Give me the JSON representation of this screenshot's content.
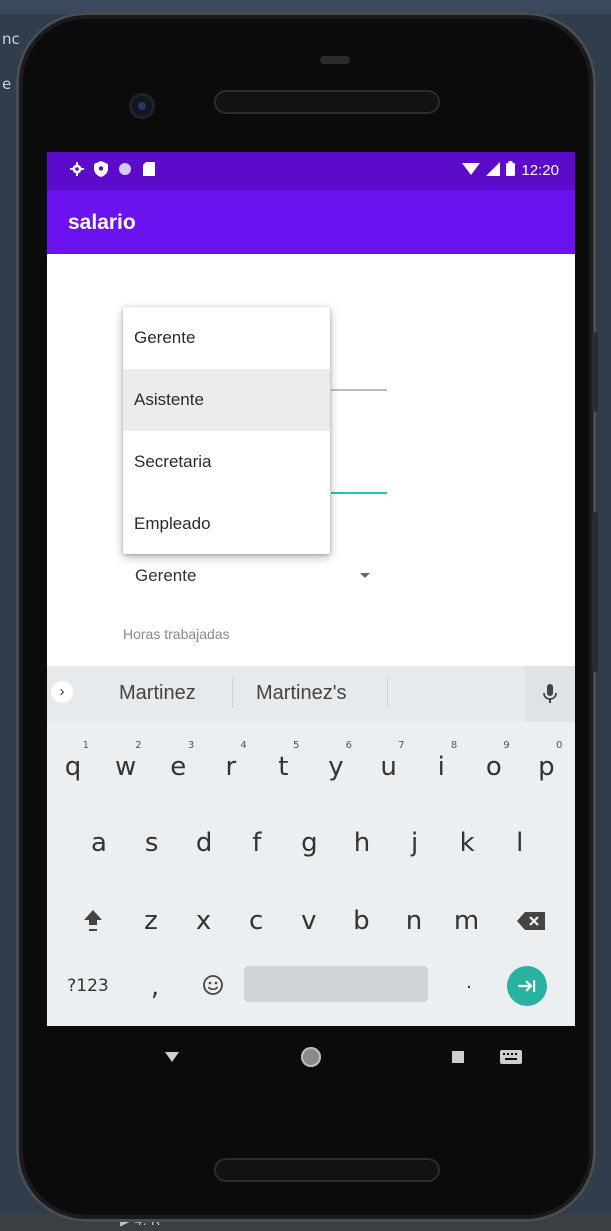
{
  "ide": {
    "top_fragment_1": "nc",
    "top_fragment_2": "e",
    "bottom_text": "▶ 4: R"
  },
  "status_bar": {
    "time": "12:20"
  },
  "app": {
    "title": "salario"
  },
  "form": {
    "spinner_selected": "Gerente",
    "hours_hint": "Horas trabajadas"
  },
  "dropdown": {
    "options": [
      "Gerente",
      "Asistente",
      "Secretaria",
      "Empleado"
    ],
    "highlighted": "Asistente"
  },
  "keyboard": {
    "suggestions": [
      "Martinez",
      "Martinez's"
    ],
    "row1": [
      {
        "key": "q",
        "hint": "1"
      },
      {
        "key": "w",
        "hint": "2"
      },
      {
        "key": "e",
        "hint": "3"
      },
      {
        "key": "r",
        "hint": "4"
      },
      {
        "key": "t",
        "hint": "5"
      },
      {
        "key": "y",
        "hint": "6"
      },
      {
        "key": "u",
        "hint": "7"
      },
      {
        "key": "i",
        "hint": "8"
      },
      {
        "key": "o",
        "hint": "9"
      },
      {
        "key": "p",
        "hint": "0"
      }
    ],
    "row2": [
      "a",
      "s",
      "d",
      "f",
      "g",
      "h",
      "j",
      "k",
      "l"
    ],
    "row3": [
      "z",
      "x",
      "c",
      "v",
      "b",
      "n",
      "m"
    ],
    "symbols_label": "?123",
    "comma_label": ",",
    "period_label": "."
  },
  "colors": {
    "status_bar": "#5b0bc9",
    "app_bar": "#6a12f0",
    "field_focus": "#27c1b5",
    "enter_key": "#27b3a0"
  }
}
